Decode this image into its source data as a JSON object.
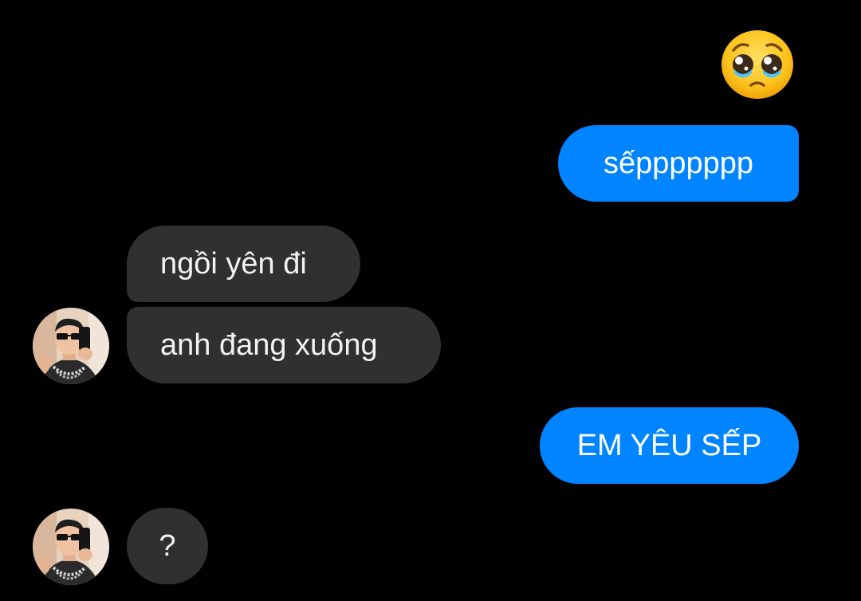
{
  "conversation": {
    "emoji_reaction": {
      "icon": "pleading-face-emoji-icon",
      "sender": "self"
    },
    "messages": [
      {
        "sender": "self",
        "text": "sếppppppp"
      },
      {
        "sender": "contact",
        "text": "ngồi yên đi"
      },
      {
        "sender": "contact",
        "text": "anh đang xuống"
      },
      {
        "sender": "self",
        "text": "EM YÊU SẾP"
      },
      {
        "sender": "contact",
        "text": "?"
      }
    ]
  },
  "colors": {
    "background": "#000000",
    "outgoing_bubble": "#0084ff",
    "incoming_bubble": "#303030",
    "bubble_text": "#ffffff"
  }
}
